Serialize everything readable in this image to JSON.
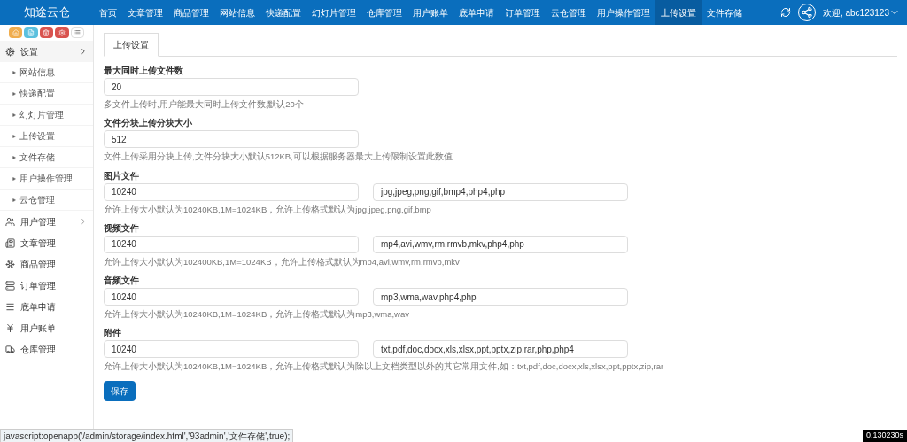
{
  "header": {
    "logo": "知途云仓",
    "nav": [
      {
        "label": "首页",
        "selected": false
      },
      {
        "label": "文章管理",
        "selected": false
      },
      {
        "label": "商品管理",
        "selected": false
      },
      {
        "label": "网站信息",
        "selected": false
      },
      {
        "label": "快递配置",
        "selected": false
      },
      {
        "label": "幻灯片管理",
        "selected": false
      },
      {
        "label": "仓库管理",
        "selected": false
      },
      {
        "label": "用户账单",
        "selected": false
      },
      {
        "label": "底单申请",
        "selected": false
      },
      {
        "label": "订单管理",
        "selected": false
      },
      {
        "label": "云仓管理",
        "selected": false
      },
      {
        "label": "用户操作管理",
        "selected": false
      },
      {
        "label": "上传设置",
        "selected": true
      },
      {
        "label": "文件存储",
        "selected": false
      }
    ],
    "user": "欢迎, abc123123"
  },
  "sidebar": {
    "items": [
      {
        "label": "设置",
        "expanded": true,
        "children": [
          {
            "label": "网站信息"
          },
          {
            "label": "快递配置"
          },
          {
            "label": "幻灯片管理"
          },
          {
            "label": "上传设置"
          },
          {
            "label": "文件存储"
          },
          {
            "label": "用户操作管理"
          },
          {
            "label": "云仓管理"
          }
        ]
      },
      {
        "label": "用户管理",
        "expanded": false
      },
      {
        "label": "文章管理"
      },
      {
        "label": "商品管理"
      },
      {
        "label": "订单管理"
      },
      {
        "label": "底单申请"
      },
      {
        "label": "用户账单"
      },
      {
        "label": "仓库管理"
      }
    ]
  },
  "tab": {
    "label": "上传设置",
    "selected": true
  },
  "fields": [
    {
      "label": "最大同时上传文件数",
      "value": "20",
      "help": "多文件上传时,用户能最大同时上传文件数,默认20个"
    },
    {
      "label": "文件分块上传分块大小",
      "value": "512",
      "help": "文件上传采用分块上传,文件分块大小默认512KB,可以根据服务器最大上传限制设置此数值"
    },
    {
      "label": "图片文件",
      "value": "10240",
      "formats": "jpg,jpeg,png,gif,bmp4,php4,php",
      "help": "允许上传大小默认为10240KB,1M=1024KB，允许上传格式默认为jpg,jpeg,png,gif,bmp"
    },
    {
      "label": "视频文件",
      "value": "10240",
      "formats": "mp4,avi,wmv,rm,rmvb,mkv,php4,php",
      "help": "允许上传大小默认为102400KB,1M=1024KB，允许上传格式默认为mp4,avi,wmv,rm,rmvb,mkv"
    },
    {
      "label": "音频文件",
      "value": "10240",
      "formats": "mp3,wma,wav,php4,php",
      "help": "允许上传大小默认为10240KB,1M=1024KB，允许上传格式默认为mp3,wma,wav"
    },
    {
      "label": "附件",
      "value": "10240",
      "formats": "txt,pdf,doc,docx,xls,xlsx,ppt,pptx,zip,rar,php,php4",
      "help": "允许上传大小默认为10240KB,1M=1024KB，允许上传格式默认为除以上文档类型以外的其它常用文件,如：txt,pdf,doc,docx,xls,xlsx,ppt,pptx,zip,rar"
    }
  ],
  "save_button": "保存",
  "status_bar": {
    "link": "javascript:openapp('/admin/storage/index.html','93admin','文件存储',true);",
    "timer": "0.130230s"
  }
}
